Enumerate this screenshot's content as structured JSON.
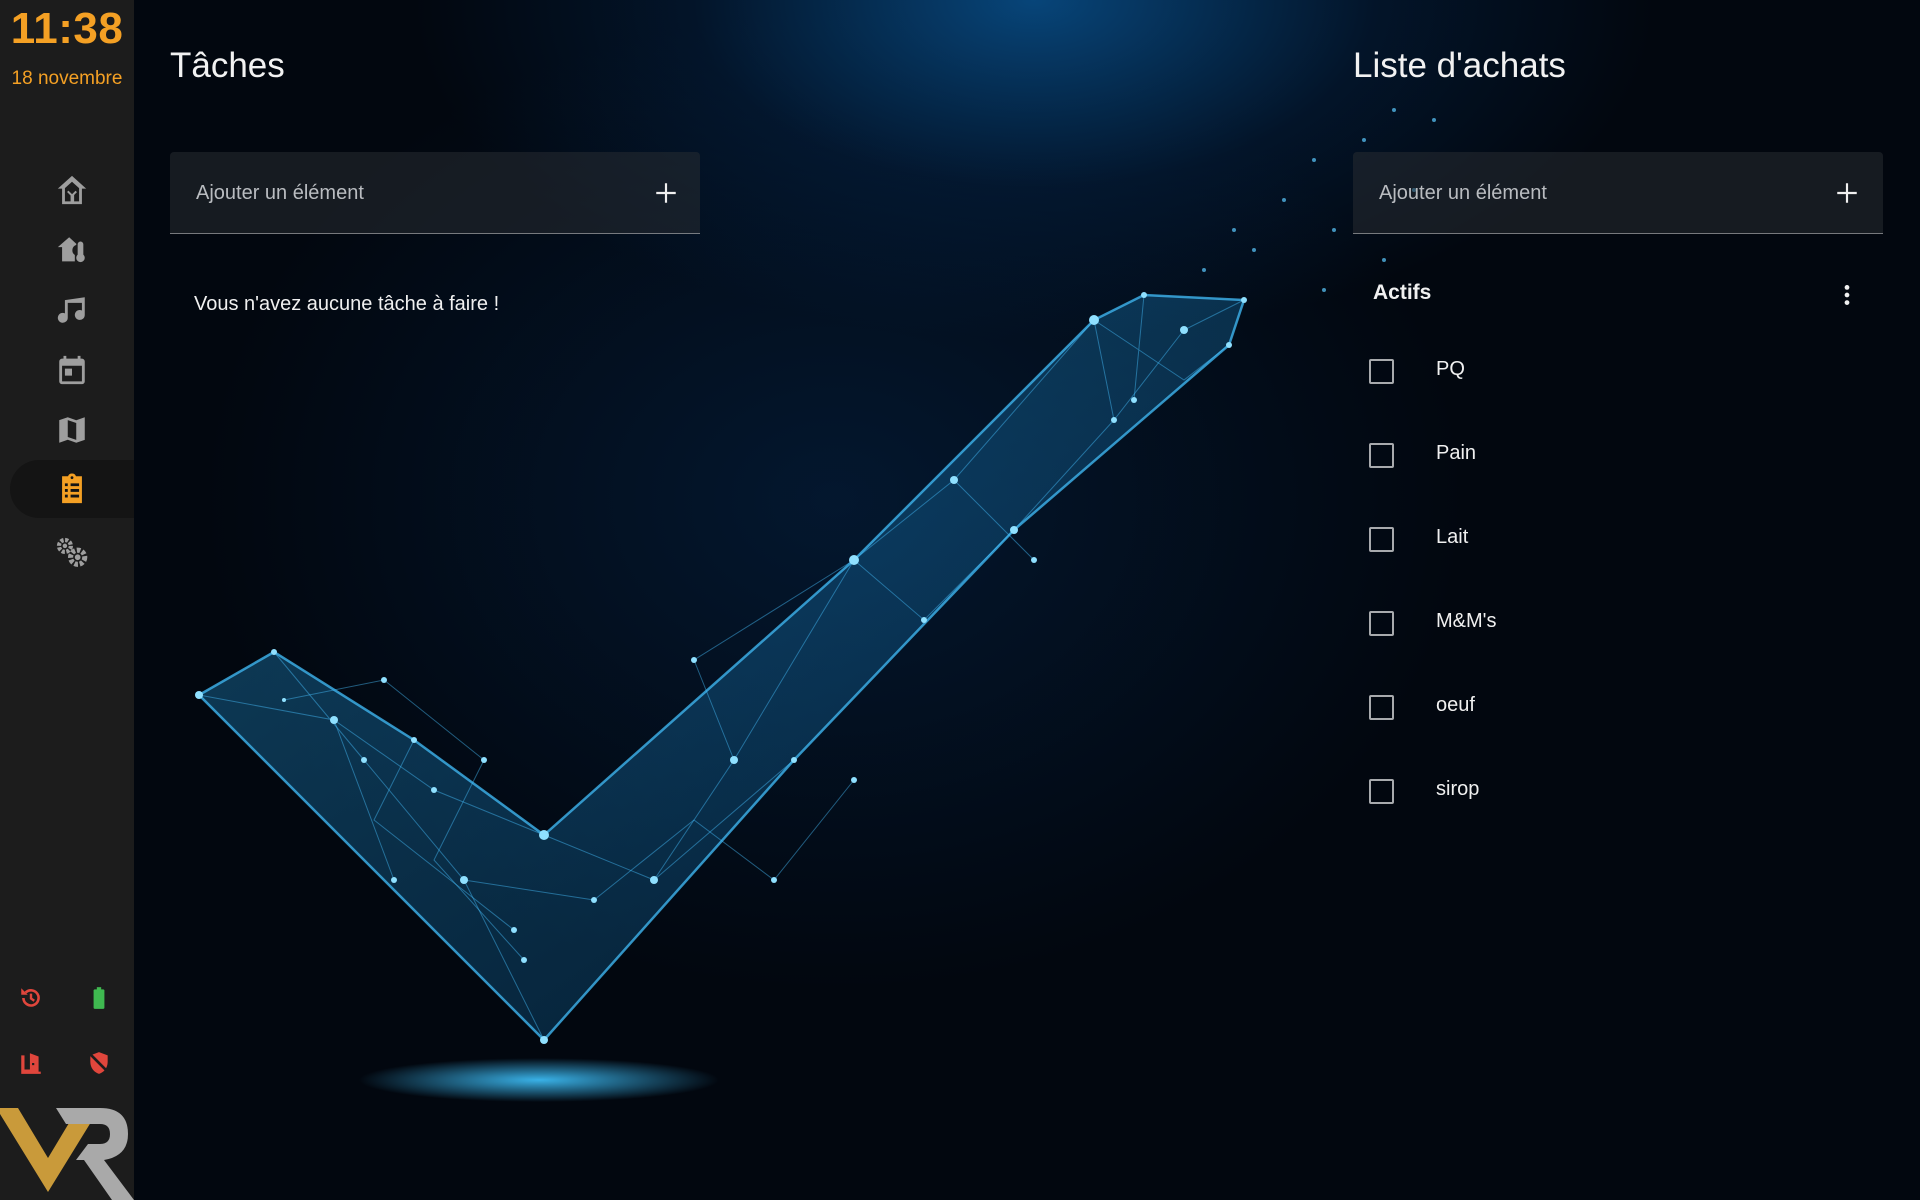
{
  "sidebar": {
    "time": "11:38",
    "date": "18 novembre",
    "accent_color": "#f4a024",
    "nav": [
      {
        "name": "home-logo-icon"
      },
      {
        "name": "home-thermometer-icon"
      },
      {
        "name": "music-icon"
      },
      {
        "name": "calendar-icon"
      },
      {
        "name": "map-icon"
      },
      {
        "name": "clipboard-list-icon",
        "active": true
      },
      {
        "name": "cogs-icon"
      }
    ],
    "status": [
      {
        "name": "restore-clock-icon",
        "color": "#e0463c"
      },
      {
        "name": "battery-icon",
        "color": "#3fb950"
      },
      {
        "name": "door-open-icon",
        "color": "#e0463c"
      },
      {
        "name": "shield-off-icon",
        "color": "#e0463c"
      }
    ],
    "logo": "MR"
  },
  "tasks": {
    "title": "Tâches",
    "add_placeholder": "Ajouter un élément",
    "empty_message": "Vous n'avez aucune tâche à faire !"
  },
  "shopping": {
    "title": "Liste d'achats",
    "add_placeholder": "Ajouter un élément",
    "section_label": "Actifs",
    "items": [
      {
        "label": "PQ",
        "checked": false
      },
      {
        "label": "Pain",
        "checked": false
      },
      {
        "label": "Lait",
        "checked": false
      },
      {
        "label": "M&M's",
        "checked": false
      },
      {
        "label": "oeuf",
        "checked": false
      },
      {
        "label": "sirop",
        "checked": false
      }
    ]
  }
}
